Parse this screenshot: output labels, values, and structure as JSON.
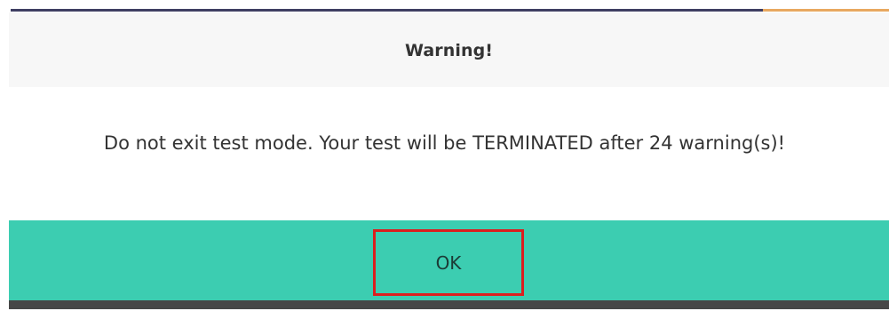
{
  "dialog": {
    "title": "Warning!",
    "message": "Do not exit test mode. Your test will be TERMINATED after 24 warning(s)!",
    "ok_label": "OK"
  },
  "colors": {
    "footer_accent": "#3ccdb1",
    "highlight_border": "#dc1e1e",
    "top_bar_dark": "#3f3f62",
    "top_bar_orange": "#e8a860"
  }
}
